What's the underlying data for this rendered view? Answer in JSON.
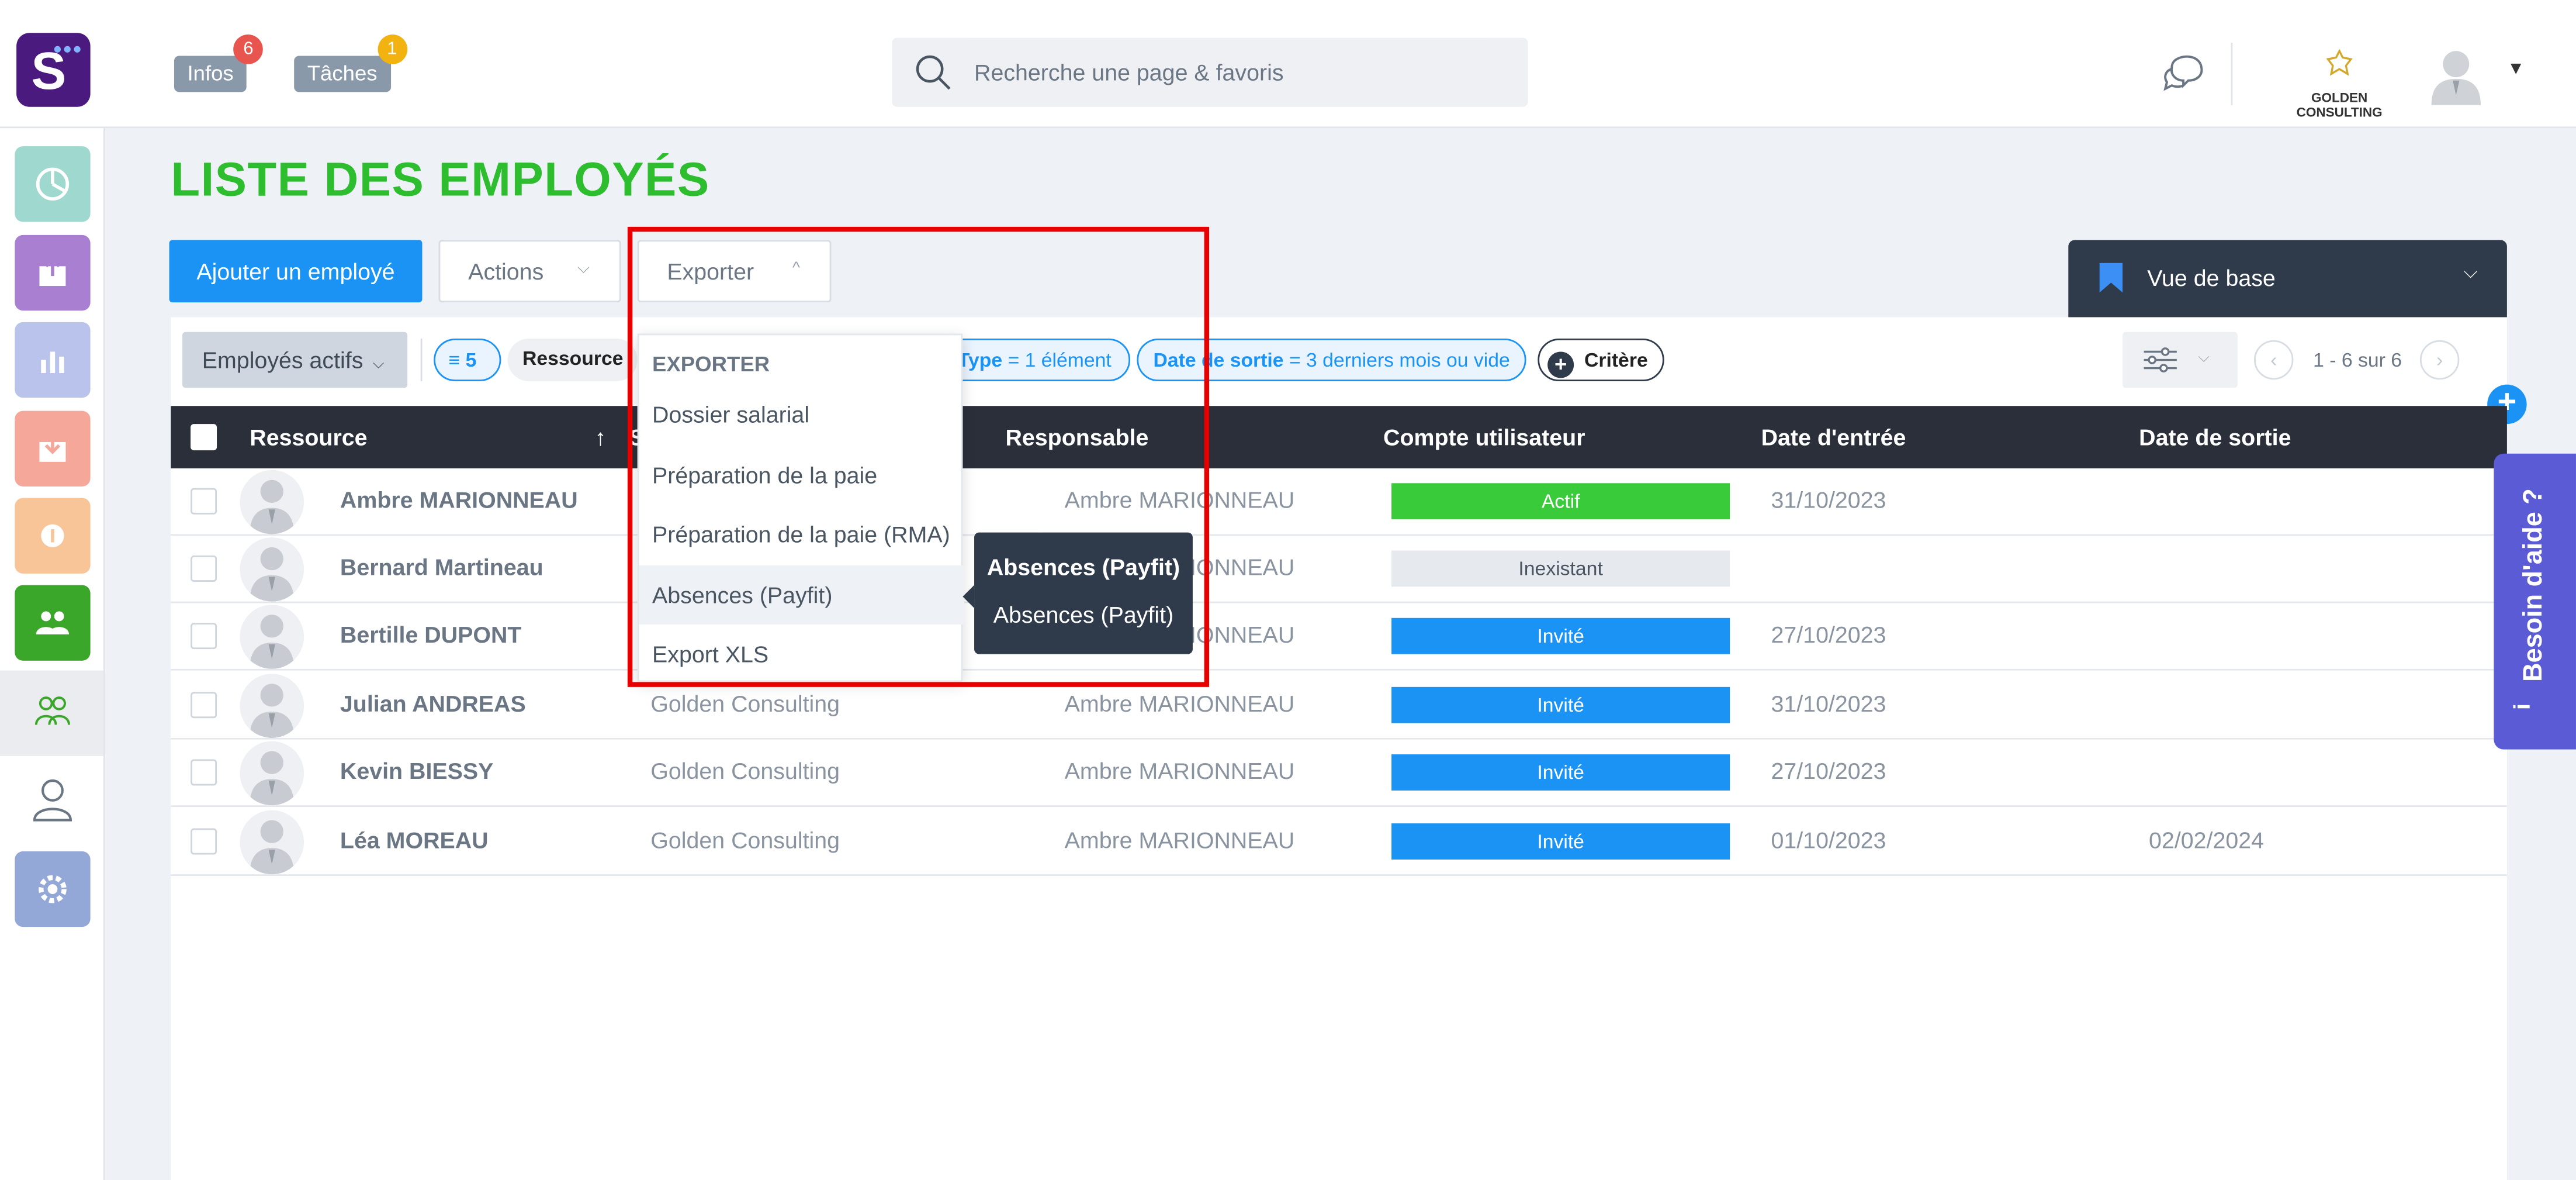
{
  "topbar": {
    "infos_label": "Infos",
    "infos_count": "6",
    "taches_label": "Tâches",
    "taches_count": "1",
    "search_placeholder": "Recherche une page & favoris",
    "company_name": "GOLDEN CONSULTING",
    "colors": {
      "infos_badge": "#e8554e",
      "taches_badge": "#f2b20f",
      "logo_bg": "#4a1a7e"
    }
  },
  "sidebar": {
    "items": [
      {
        "icon": "dashboard-icon",
        "color": "#9fd8cf"
      },
      {
        "icon": "upload-icon",
        "color": "#a97fd1"
      },
      {
        "icon": "bar-chart-icon",
        "color": "#b9c3eb"
      },
      {
        "icon": "download-icon",
        "color": "#f5a89a"
      },
      {
        "icon": "money-icon",
        "color": "#f7c598"
      },
      {
        "icon": "team-icon",
        "color": "#3ba72a"
      },
      {
        "icon": "employees-icon",
        "active": true
      },
      {
        "icon": "user-icon"
      },
      {
        "icon": "settings-icon",
        "color": "#94a8d8"
      }
    ]
  },
  "page": {
    "title": "LISTE DES EMPLOYÉS",
    "add_button": "Ajouter un employé",
    "actions_button": "Actions",
    "export_button": "Exporter",
    "view_label": "Vue de base"
  },
  "filters": {
    "active_filter": "Employés actifs",
    "count": "5",
    "chip_resource": "Ressource",
    "chip_type_key": "Type",
    "chip_type_val": "= 1 élément",
    "chip_date_key": "Date de sortie",
    "chip_date_val": "= 3 derniers mois ou vide",
    "chip_critere": "Critère",
    "pager": "1 - 6 sur 6"
  },
  "table": {
    "headers": {
      "ressource": "Ressource",
      "sort_arrow": "↑",
      "societe_partial": "S",
      "responsable": "Responsable",
      "compte": "Compte utilisateur",
      "date_entree": "Date d'entrée",
      "date_sortie": "Date de sortie"
    },
    "rows": [
      {
        "name": "Ambre MARIONNEAU",
        "company": "",
        "manager": "Ambre MARIONNEAU",
        "status": "Actif",
        "status_color": "#3acb3a",
        "start": "31/10/2023",
        "end": ""
      },
      {
        "name": "Bernard Martineau",
        "company": "",
        "manager": "Ambre MARIONNEAU",
        "status": "Inexistant",
        "status_color": "#e6e9ed",
        "start": "",
        "end": ""
      },
      {
        "name": "Bertille DUPONT",
        "company": "",
        "manager": "Ambre MARIONNEAU",
        "status": "Invité",
        "status_color": "#1a93f5",
        "start": "27/10/2023",
        "end": ""
      },
      {
        "name": "Julian ANDREAS",
        "company": "Golden Consulting",
        "manager": "Ambre MARIONNEAU",
        "status": "Invité",
        "status_color": "#1a93f5",
        "start": "31/10/2023",
        "end": ""
      },
      {
        "name": "Kevin BIESSY",
        "company": "Golden Consulting",
        "manager": "Ambre MARIONNEAU",
        "status": "Invité",
        "status_color": "#1a93f5",
        "start": "27/10/2023",
        "end": ""
      },
      {
        "name": "Léa MOREAU",
        "company": "Golden Consulting",
        "manager": "Ambre MARIONNEAU",
        "status": "Invité",
        "status_color": "#1a93f5",
        "start": "01/10/2023",
        "end": "02/02/2024"
      }
    ]
  },
  "export_menu": {
    "header": "EXPORTER",
    "items": [
      "Dossier salarial",
      "Préparation de la paie",
      "Préparation de la paie (RMA)",
      "Absences (Payfit)",
      "Export XLS"
    ],
    "hovered_index": 3
  },
  "tooltip": {
    "title": "Absences (Payfit)",
    "body": "Absences (Payfit)"
  },
  "help": {
    "label": "Besoin d'aide ?",
    "icon": "info-icon",
    "color": "#5b5bd6"
  }
}
